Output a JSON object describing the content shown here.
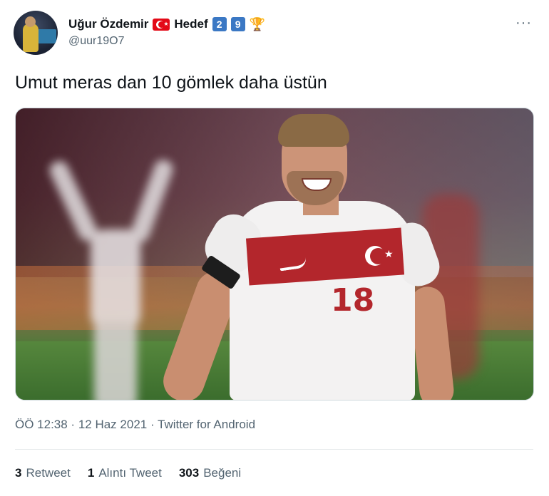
{
  "user": {
    "display_name": "Uğur Özdemir",
    "hedef_label": "Hedef",
    "badge_digit_1": "2",
    "badge_digit_2": "9",
    "handle": "@uur19O7",
    "flag_icon": "turkey-flag-icon",
    "trophy_icon": "trophy-icon"
  },
  "more_menu": {
    "label": "···"
  },
  "tweet": {
    "text": "Umut meras dan 10 gömlek daha üstün",
    "photo_description_icon": "photo-footballer"
  },
  "meta": {
    "timestamp": "ÖÖ 12:38 · 12 Haz 2021 · Twitter for Android"
  },
  "stats": {
    "retweet_count": "3",
    "retweet_label": "Retweet",
    "quote_count": "1",
    "quote_label": "Alıntı Tweet",
    "like_count": "303",
    "like_label": "Beğeni"
  },
  "jersey": {
    "number": "18"
  },
  "colors": {
    "accent_red": "#e30a17",
    "badge_blue": "#3b78c4",
    "muted_text": "#536471"
  }
}
